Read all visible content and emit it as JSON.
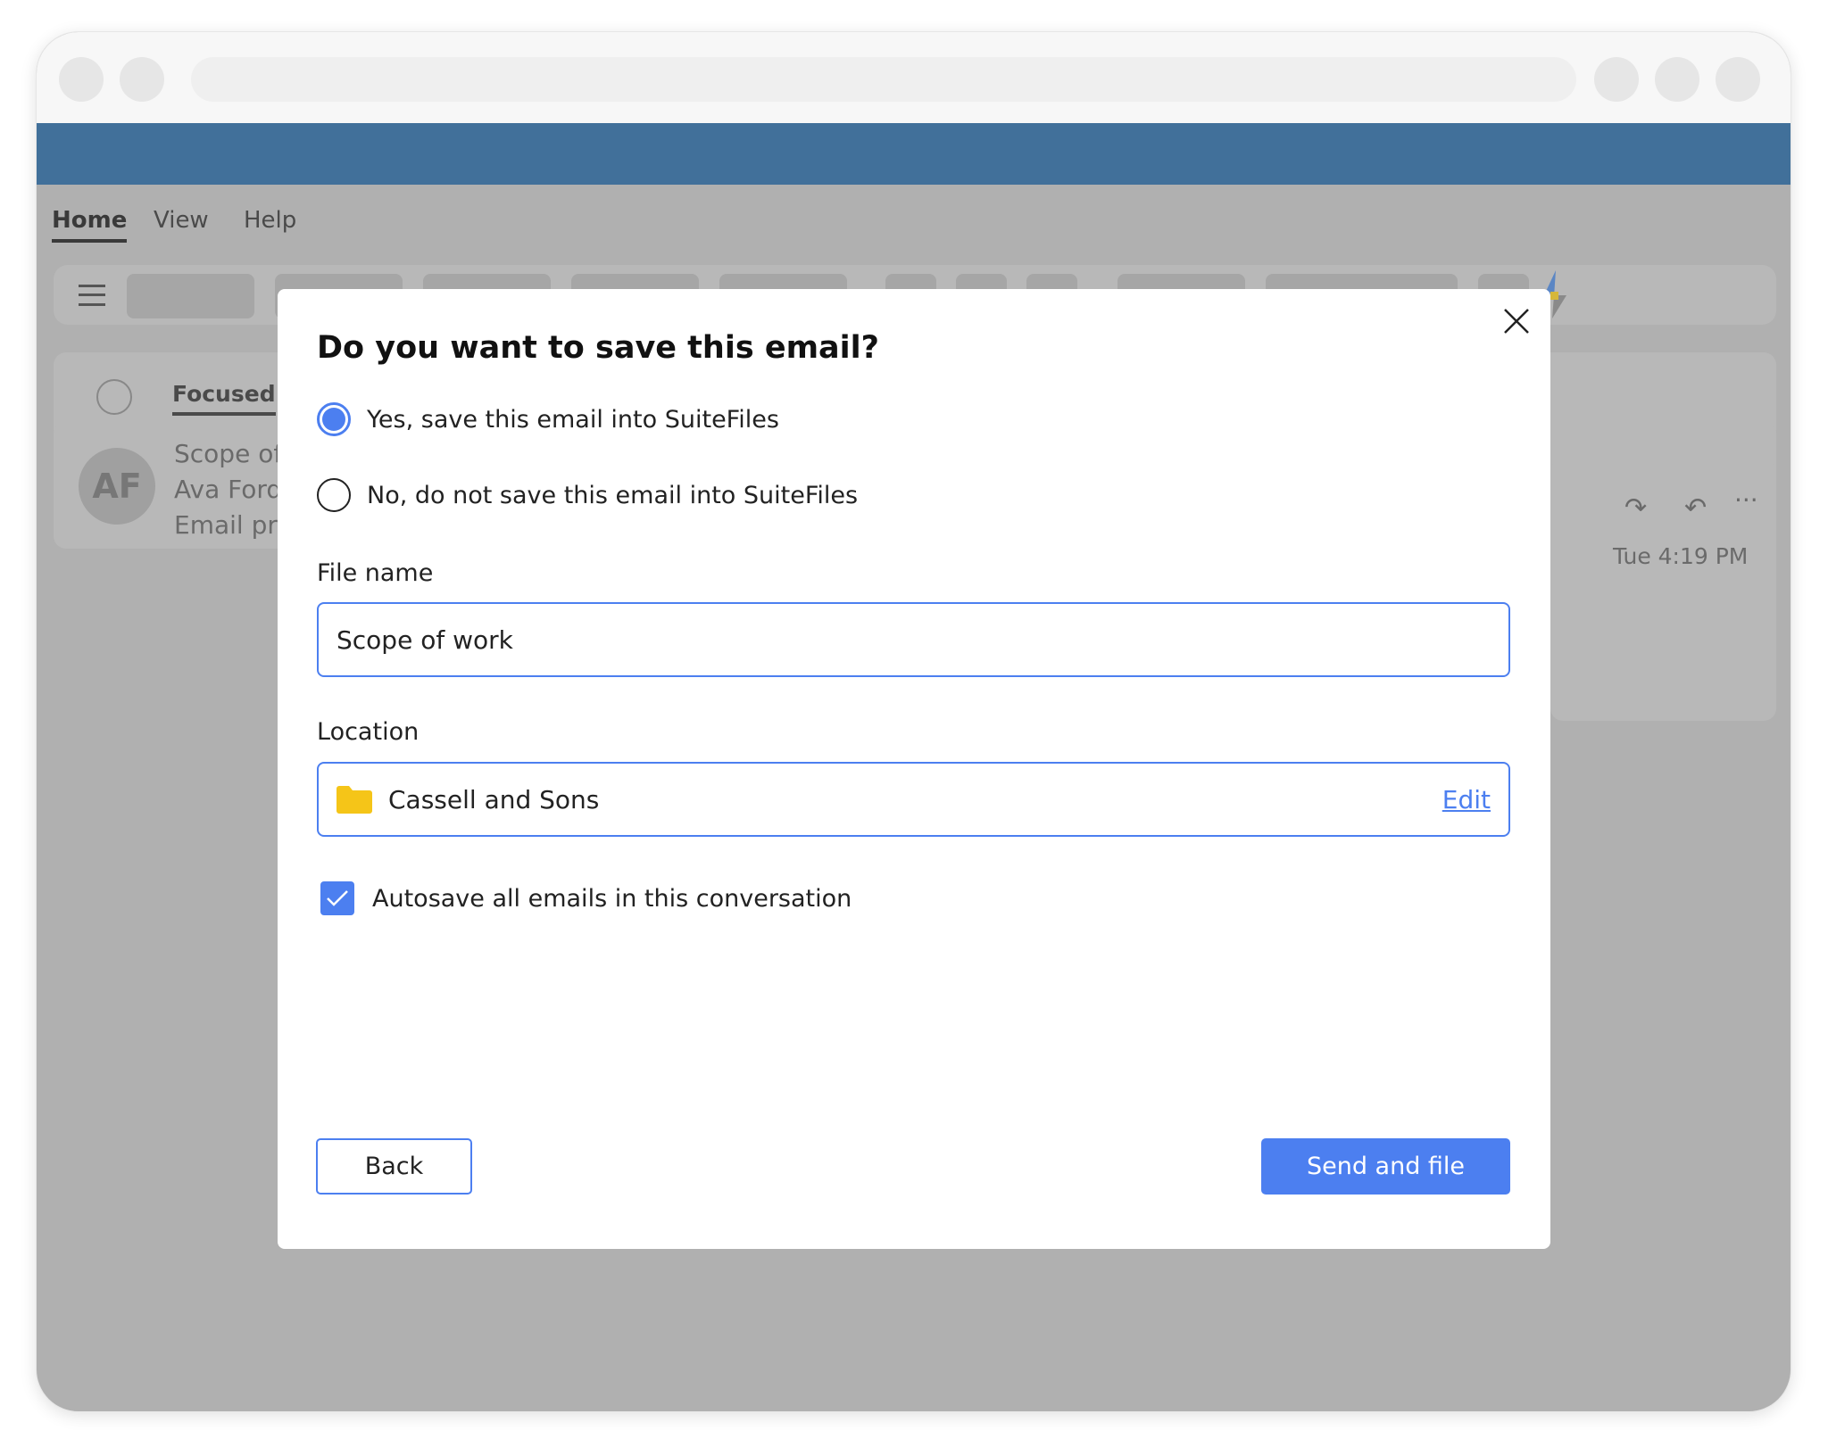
{
  "menu": {
    "tabs": [
      {
        "label": "Home",
        "active": true
      },
      {
        "label": "View"
      },
      {
        "label": "Help"
      }
    ]
  },
  "mail": {
    "filter_label": "Focused",
    "item": {
      "avatar_initials": "AF",
      "subject": "Scope of",
      "sender": "Ava Ford",
      "preview": "Email pre"
    },
    "timestamp": "Tue 4:19 PM"
  },
  "dialog": {
    "title": "Do you want to save this email?",
    "options": [
      {
        "label": "Yes, save this email into SuiteFiles",
        "selected": true
      },
      {
        "label": "No, do not save this email into SuiteFiles",
        "selected": false
      }
    ],
    "file_name_label": "File name",
    "file_name_value": "Scope of work",
    "location_label": "Location",
    "location_value": "Cassell and Sons",
    "location_edit": "Edit",
    "autosave_label": "Autosave all emails in this conversation",
    "autosave_checked": true,
    "back_label": "Back",
    "send_label": "Send and file"
  },
  "colors": {
    "accent": "#4c7ff0",
    "header_band": "#41709a",
    "folder": "#f5c518"
  }
}
